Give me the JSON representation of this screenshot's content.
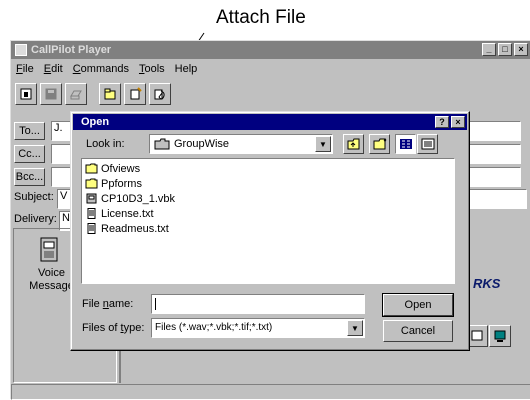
{
  "callout": {
    "label": "Attach File"
  },
  "window": {
    "title": "CallPilot Player",
    "controls": [
      "_",
      "□",
      "×"
    ],
    "menus": [
      {
        "u": "F",
        "rest": "ile"
      },
      {
        "u": "E",
        "rest": "dit"
      },
      {
        "u": "C",
        "rest": "ommands"
      },
      {
        "u": "T",
        "rest": "ools"
      },
      {
        "u": "",
        "rest": "Help"
      }
    ],
    "toolbar_icons": [
      "printer-icon",
      "save-icon",
      "print-icon",
      "new-folder-icon",
      "notes-icon",
      "attach-file-icon"
    ],
    "to_label": "To...",
    "to_value": "J.",
    "cc_label": "Cc...",
    "bcc_label": "Bcc...",
    "subject_label": "Subject:",
    "subject_value": "V",
    "delivery_label": "Delivery:",
    "delivery_value": "N",
    "voice_message": [
      "Voice",
      "Message"
    ],
    "brand_fragment": "RKS"
  },
  "dialog": {
    "title": "Open",
    "controls": [
      "?",
      "×"
    ],
    "look_in_label": "Look in:",
    "look_in_value": "GroupWise",
    "files": [
      {
        "name": "Ofviews",
        "icon": "folder-icon"
      },
      {
        "name": "Ppforms",
        "icon": "folder-icon"
      },
      {
        "name": "CP10D3_1.vbk",
        "icon": "vbk-file-icon"
      },
      {
        "name": "License.txt",
        "icon": "text-file-icon"
      },
      {
        "name": "Readmeus.txt",
        "icon": "text-file-icon"
      }
    ],
    "file_name_label": "File name:",
    "file_name_value": "",
    "files_of_type_label": "Files of type:",
    "files_of_type_value": "Files (*.wav;*.vbk;*.tif;*.txt)",
    "open_button": "Open",
    "cancel_button": "Cancel"
  }
}
